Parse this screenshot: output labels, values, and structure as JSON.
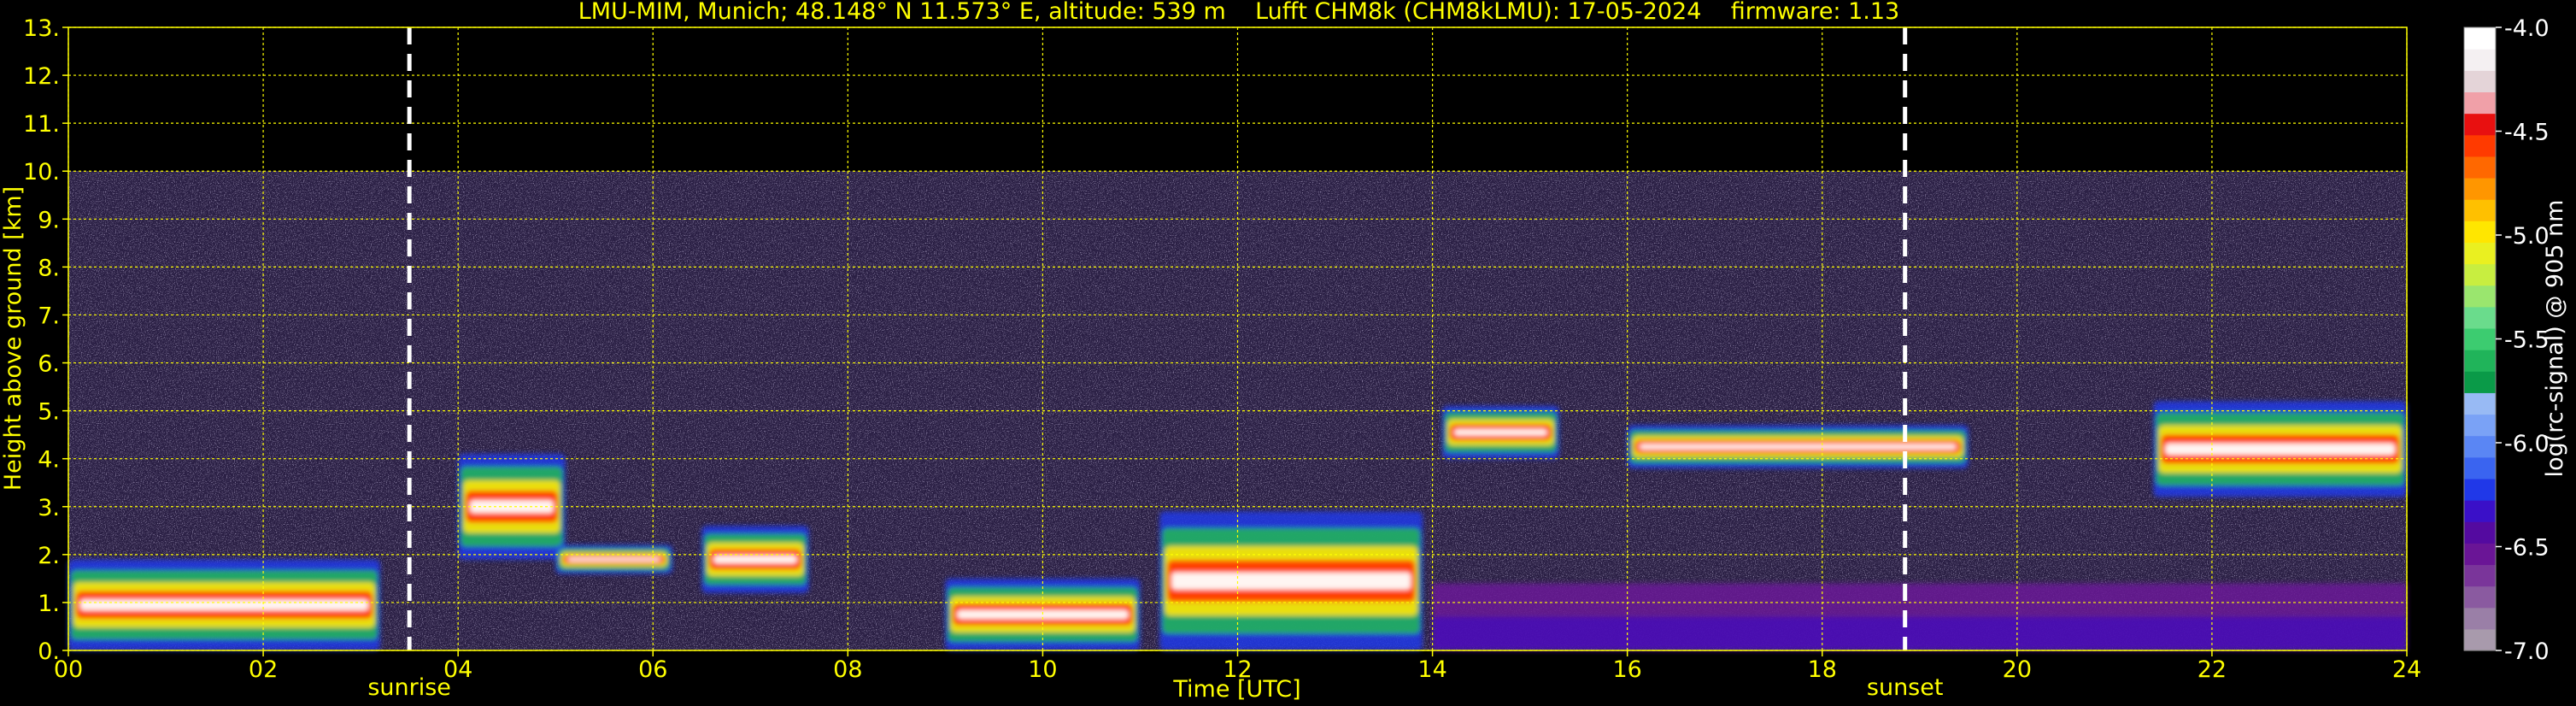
{
  "chart_data": {
    "type": "heatmap",
    "title": "LMU-MIM, Munich; 48.148° N 11.573° E, altitude: 539 m    Lufft CHM8k (CHM8kLMU): 17-05-2024    firmware: 1.13",
    "xlabel": "Time [UTC]",
    "ylabel": "Height above ground [km]",
    "xlim": [
      0,
      24
    ],
    "ylim": [
      0,
      13
    ],
    "x_ticks": [
      "00",
      "02",
      "04",
      "06",
      "08",
      "10",
      "12",
      "14",
      "16",
      "18",
      "20",
      "22",
      "24"
    ],
    "y_ticks": [
      "0.",
      "1.",
      "2.",
      "3.",
      "4.",
      "5.",
      "6.",
      "7.",
      "8.",
      "9.",
      "10.",
      "11.",
      "12.",
      "13."
    ],
    "grid": true,
    "grid_color": "#ffff00",
    "data_ceiling_km": 10,
    "markers": [
      {
        "label": "sunrise",
        "x": 3.5
      },
      {
        "label": "sunset",
        "x": 18.85
      }
    ],
    "colorbar": {
      "label": "log(rc-signal) @ 905 nm",
      "range": [
        -7.0,
        -4.0
      ],
      "ticks": [
        "-4.0",
        "-4.5",
        "-5.0",
        "-5.5",
        "-6.0",
        "-6.5",
        "-7.0"
      ],
      "colors": [
        "#a89aac",
        "#9a7fa7",
        "#8a5aa0",
        "#7a359a",
        "#6a1596",
        "#540aa0",
        "#3a10c8",
        "#2038e8",
        "#3a64f0",
        "#5a86f4",
        "#7aa2f6",
        "#98baf4",
        "#0a9a48",
        "#20b45a",
        "#3ccc70",
        "#6adc8c",
        "#9ae66e",
        "#c8ee40",
        "#eaf020",
        "#ffe600",
        "#ffc000",
        "#ff9600",
        "#ff6800",
        "#ff3a00",
        "#e81010",
        "#f0a0a8",
        "#e4d4d8",
        "#f4f0f2",
        "#ffffff"
      ]
    },
    "features": [
      {
        "name": "low layer 00-03",
        "x": [
          0.0,
          3.2
        ],
        "y": [
          0.0,
          1.9
        ]
      },
      {
        "name": "cloud 04-05",
        "x": [
          4.0,
          5.1
        ],
        "y": [
          1.9,
          4.1
        ]
      },
      {
        "name": "layer 05-06",
        "x": [
          5.0,
          6.2
        ],
        "y": [
          1.6,
          2.2
        ]
      },
      {
        "name": "cloud 06.5-07.5",
        "x": [
          6.5,
          7.6
        ],
        "y": [
          1.2,
          2.6
        ]
      },
      {
        "name": "convective 09-11",
        "x": [
          9.0,
          11.0
        ],
        "y": [
          0.0,
          1.5
        ]
      },
      {
        "name": "convective 11-14",
        "x": [
          11.2,
          13.9
        ],
        "y": [
          0.0,
          2.9
        ]
      },
      {
        "name": "elevated layer 14-15",
        "x": [
          14.1,
          15.3
        ],
        "y": [
          4.0,
          5.1
        ]
      },
      {
        "name": "elevated layer 16-19",
        "x": [
          16.0,
          19.5
        ],
        "y": [
          3.8,
          4.7
        ]
      },
      {
        "name": "elevated layer 21-24",
        "x": [
          21.4,
          24.0
        ],
        "y": [
          3.2,
          5.2
        ]
      },
      {
        "name": "boundary layer evening",
        "x": [
          14.0,
          24.0
        ],
        "y": [
          0.0,
          1.4
        ]
      }
    ]
  }
}
